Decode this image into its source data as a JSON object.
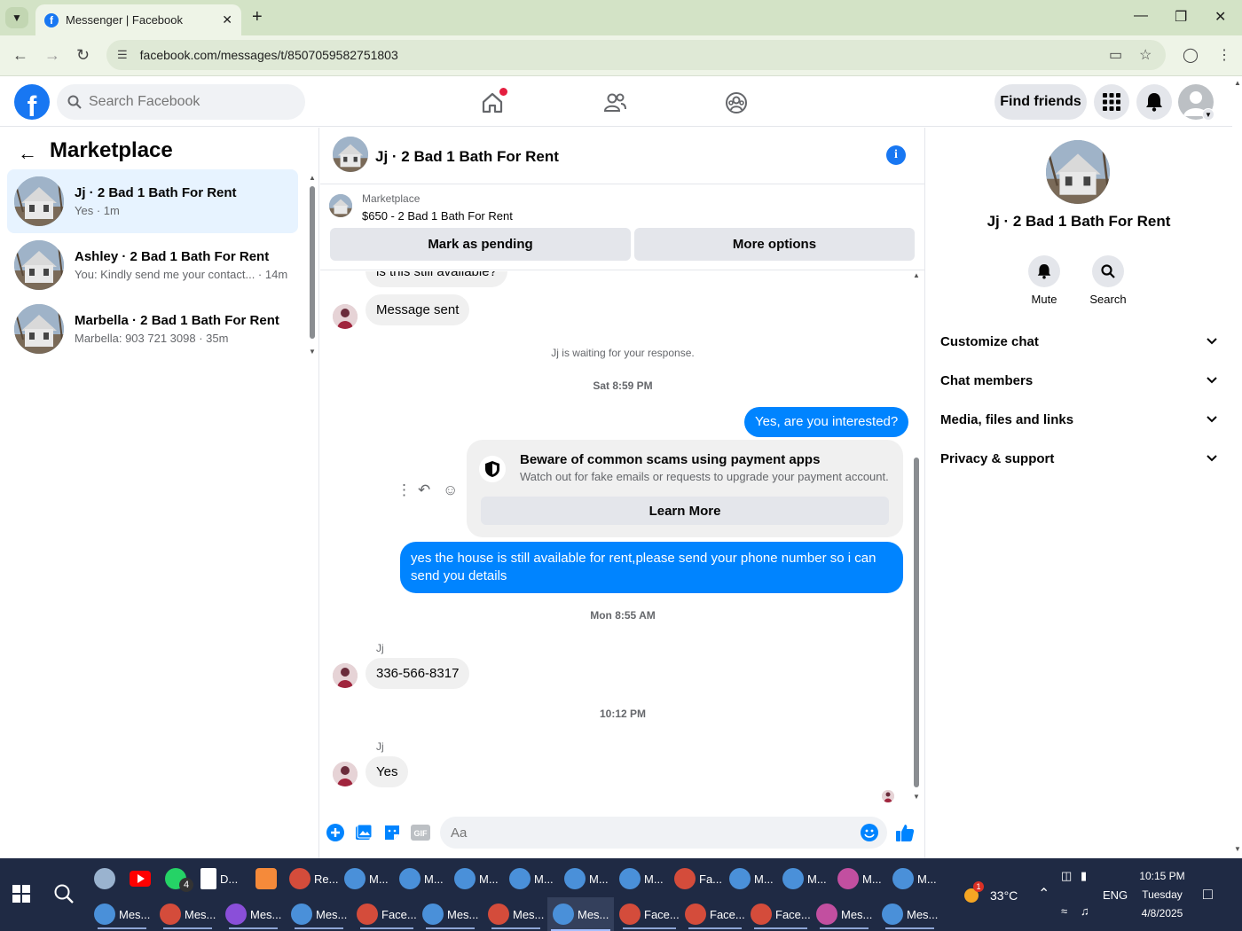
{
  "browser": {
    "tab_title": "Messenger | Facebook",
    "url": "facebook.com/messages/t/8507059582751803"
  },
  "header": {
    "search_placeholder": "Search Facebook",
    "find_friends": "Find friends"
  },
  "left_panel": {
    "title": "Marketplace",
    "conversations": [
      {
        "name": "Jj · 2 Bad 1 Bath For Rent",
        "preview": "Yes · 1m"
      },
      {
        "name": "Ashley · 2 Bad 1 Bath For Rent",
        "preview": "You: Kindly send me your contact... · 14m"
      },
      {
        "name": "Marbella · 2 Bad 1 Bath For Rent",
        "preview": "Marbella: 903 721 3098 · 35m"
      }
    ]
  },
  "chat": {
    "title": "Jj · 2 Bad 1 Bath For Rent",
    "marketplace_label": "Marketplace",
    "listing": "$650 - 2 Bad 1 Bath For Rent",
    "mark_pending": "Mark as pending",
    "more_options": "More options",
    "messages": {
      "partial": "is this still available?",
      "sent_notice": "Message sent",
      "waiting": "Jj is waiting for your response.",
      "ts1": "Sat 8:59 PM",
      "out1": "Yes, are you interested?",
      "scam_title": "Beware of common scams using payment apps",
      "scam_sub": "Watch out for fake emails or requests to upgrade your payment account.",
      "learn_more": "Learn More",
      "out2": "yes the house is still available for rent,please send your phone number so i can send you details",
      "ts2": "Mon 8:55 AM",
      "sender1": "Jj",
      "in1": "336-566-8317",
      "ts3": "10:12 PM",
      "sender2": "Jj",
      "in2": "Yes"
    },
    "composer_placeholder": "Aa"
  },
  "right_panel": {
    "name": "Jj · 2 Bad 1 Bath For Rent",
    "mute": "Mute",
    "search": "Search",
    "sections": [
      "Customize chat",
      "Chat members",
      "Media, files and links",
      "Privacy & support"
    ]
  },
  "taskbar": {
    "row1": [
      "D...",
      "Re...",
      "M...",
      "M...",
      "M...",
      "M...",
      "M...",
      "M...",
      "Fa...",
      "M...",
      "M...",
      "M...",
      "M..."
    ],
    "row2": [
      "Mes...",
      "Mes...",
      "Mes...",
      "Mes...",
      "Face...",
      "Mes...",
      "Mes...",
      "Mes...",
      "Face...",
      "Face...",
      "Face...",
      "Mes...",
      "Mes..."
    ],
    "whatsapp_badge": "4",
    "weather_badge": "1",
    "temperature": "33°C",
    "language": "ENG",
    "time": "10:15 PM",
    "day": "Tuesday",
    "date": "4/8/2025"
  }
}
